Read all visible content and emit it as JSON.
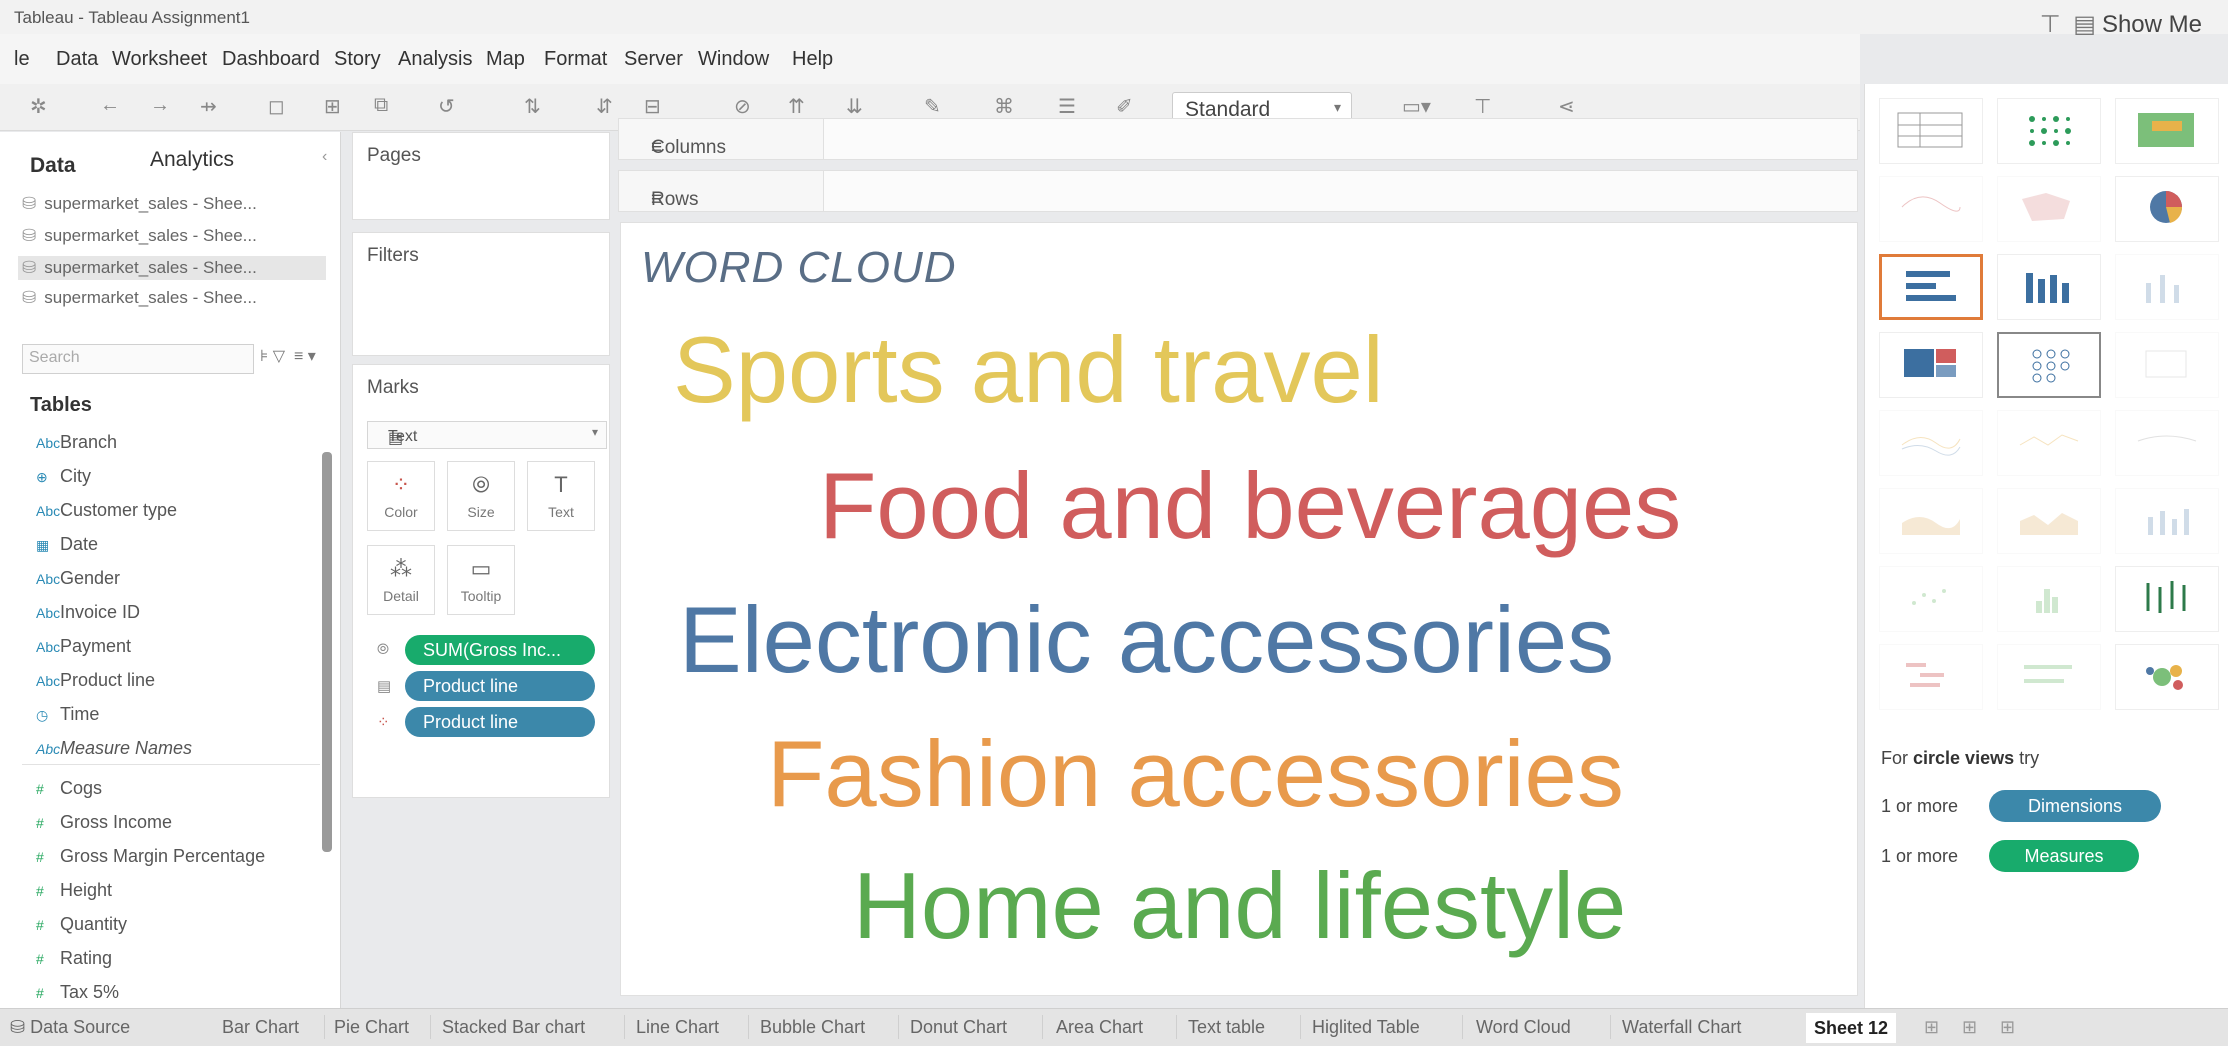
{
  "window": {
    "title": "Tableau - Tableau Assignment1"
  },
  "menu": [
    "le",
    "Data",
    "Worksheet",
    "Dashboard",
    "Story",
    "Analysis",
    "Map",
    "Format",
    "Server",
    "Window",
    "Help"
  ],
  "toolbar": {
    "fit_value": "Standard",
    "show_me_label": "Show Me"
  },
  "data_pane": {
    "tabs": [
      "Data",
      "Analytics"
    ],
    "sources": [
      "supermarket_sales - Shee...",
      "supermarket_sales - Shee...",
      "supermarket_sales - Shee...",
      "supermarket_sales - Shee..."
    ],
    "search_placeholder": "Search",
    "tables_heading": "Tables",
    "dimensions": [
      "Branch",
      "City",
      "Customer type",
      "Date",
      "Gender",
      "Invoice ID",
      "Payment",
      "Product line",
      "Time",
      "Measure Names"
    ],
    "measures": [
      "Cogs",
      "Gross Income",
      "Gross Margin Percentage",
      "Height",
      "Quantity",
      "Rating",
      "Tax 5%"
    ]
  },
  "shelves": {
    "pages": "Pages",
    "filters": "Filters",
    "marks": "Marks",
    "mark_type": "Text",
    "columns": "Columns",
    "rows": "Rows"
  },
  "marks_buttons": [
    "Color",
    "Size",
    "Text",
    "Detail",
    "Tooltip"
  ],
  "marks_pills": [
    "SUM(Gross Inc...",
    "Product line",
    "Product line"
  ],
  "view": {
    "title": "WORD CLOUD",
    "words": [
      {
        "text": "Sports and travel",
        "color": "#e3c75a"
      },
      {
        "text": "Food and beverages",
        "color": "#d05d5d"
      },
      {
        "text": "Electronic accessories",
        "color": "#4f78a5"
      },
      {
        "text": "Fashion accessories",
        "color": "#e89a4c"
      },
      {
        "text": "Home and lifestyle",
        "color": "#5aaa50"
      }
    ]
  },
  "show_me": {
    "hint_prefix": "For",
    "hint_bold": "circle views",
    "hint_suffix": "try",
    "req1_prefix": "1 or more",
    "req1_pill": "Dimensions",
    "req2_prefix": "1 or more",
    "req2_pill": "Measures"
  },
  "sheet_tabs": [
    "Data Source",
    "Bar Chart",
    "Pie Chart",
    "Stacked Bar chart",
    "Line Chart",
    "Bubble Chart",
    "Donut Chart",
    "Area Chart",
    "Text table",
    "Higlited Table",
    "Word Cloud",
    "Waterfall Chart",
    "Sheet 12"
  ]
}
